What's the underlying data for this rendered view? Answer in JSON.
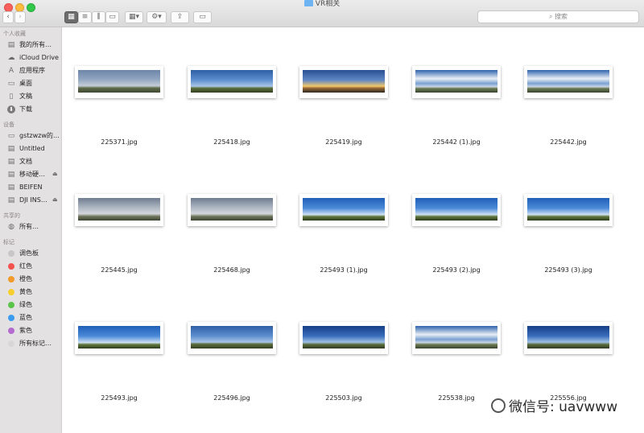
{
  "window": {
    "title": "VR相关"
  },
  "search": {
    "placeholder": "搜索"
  },
  "sidebar": {
    "sections": [
      {
        "title": "个人收藏",
        "items": [
          {
            "icon": "all-files-icon",
            "label": "我的所有…"
          },
          {
            "icon": "cloud-icon",
            "label": "iCloud Drive"
          },
          {
            "icon": "applications-icon",
            "label": "应用程序"
          },
          {
            "icon": "desktop-icon",
            "label": "桌面"
          },
          {
            "icon": "document-icon",
            "label": "文稿"
          },
          {
            "icon": "downloads-icon",
            "label": "下载"
          }
        ]
      },
      {
        "title": "设备",
        "items": [
          {
            "icon": "computer-icon",
            "label": "gstzwzw的…"
          },
          {
            "icon": "disk-icon",
            "label": "Untitled"
          },
          {
            "icon": "disk-icon",
            "label": "文档"
          },
          {
            "icon": "disk-icon",
            "label": "移动硬…",
            "eject": true
          },
          {
            "icon": "disk-icon",
            "label": "BEIFEN"
          },
          {
            "icon": "disk-icon",
            "label": "DJI INS…",
            "eject": true
          }
        ]
      },
      {
        "title": "共享的",
        "items": [
          {
            "icon": "network-icon",
            "label": "所有…"
          }
        ]
      },
      {
        "title": "标记",
        "items": [
          {
            "icon": "tag-icon",
            "label": "调色板",
            "color": "#c9c6c7"
          },
          {
            "icon": "tag-icon",
            "label": "红色",
            "color": "#f2534e"
          },
          {
            "icon": "tag-icon",
            "label": "橙色",
            "color": "#f39a2c"
          },
          {
            "icon": "tag-icon",
            "label": "黄色",
            "color": "#f6cf2e"
          },
          {
            "icon": "tag-icon",
            "label": "绿色",
            "color": "#5bc44a"
          },
          {
            "icon": "tag-icon",
            "label": "蓝色",
            "color": "#3b9bf0"
          },
          {
            "icon": "tag-icon",
            "label": "紫色",
            "color": "#b36bd0"
          },
          {
            "icon": "tag-icon",
            "label": "所有标记…",
            "color": "#d9d6d7"
          }
        ]
      }
    ]
  },
  "files": [
    {
      "name": "225371.jpg",
      "sky": "cloudy"
    },
    {
      "name": "225418.jpg",
      "sky": "clear"
    },
    {
      "name": "225419.jpg",
      "sky": "sunset"
    },
    {
      "name": "225442 (1).jpg",
      "sky": "clouds"
    },
    {
      "name": "225442.jpg",
      "sky": "clouds"
    },
    {
      "name": "225445.jpg",
      "sky": "overcast"
    },
    {
      "name": "225468.jpg",
      "sky": "overcast"
    },
    {
      "name": "225493 (1).jpg",
      "sky": "bright"
    },
    {
      "name": "225493 (2).jpg",
      "sky": "bright"
    },
    {
      "name": "225493 (3).jpg",
      "sky": "bright"
    },
    {
      "name": "225493.jpg",
      "sky": "bright"
    },
    {
      "name": "225496.jpg",
      "sky": "clear"
    },
    {
      "name": "225503.jpg",
      "sky": "deep"
    },
    {
      "name": "225538.jpg",
      "sky": "clouds"
    },
    {
      "name": "225556.jpg",
      "sky": "deep"
    }
  ],
  "watermark": {
    "text": "微信号: uavwww"
  },
  "colors": {
    "accent": "#6d6d6d",
    "folder": "#6fb4f2"
  }
}
